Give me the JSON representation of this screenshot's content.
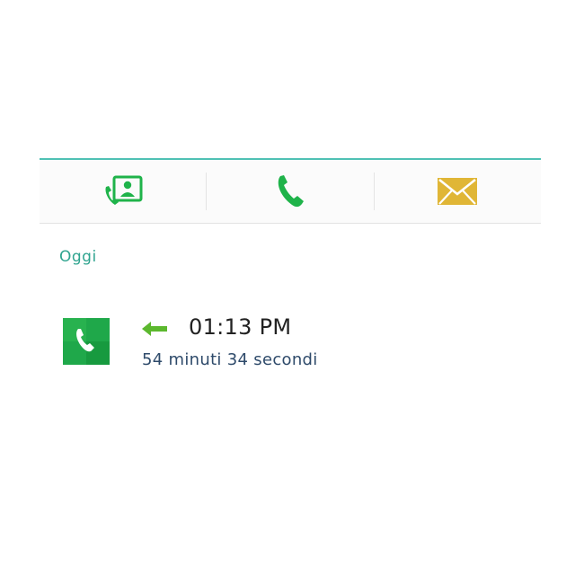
{
  "toolbar": {
    "actions": [
      {
        "name": "contact-details",
        "icon": "contact-card-phone-icon"
      },
      {
        "name": "call",
        "icon": "phone-icon"
      },
      {
        "name": "message",
        "icon": "envelope-icon"
      }
    ]
  },
  "colors": {
    "accent_rule": "#4fc1b4",
    "section_label": "#2fa48f",
    "green": "#1fb34a",
    "envelope": "#e0b636",
    "duration_text": "#2e4a6a"
  },
  "log": {
    "section_label": "Oggi",
    "entries": [
      {
        "type_icon": "phone-icon",
        "direction_icon": "arrow-left-icon",
        "time": "01:13 PM",
        "duration": "54 minuti 34 secondi"
      }
    ]
  }
}
